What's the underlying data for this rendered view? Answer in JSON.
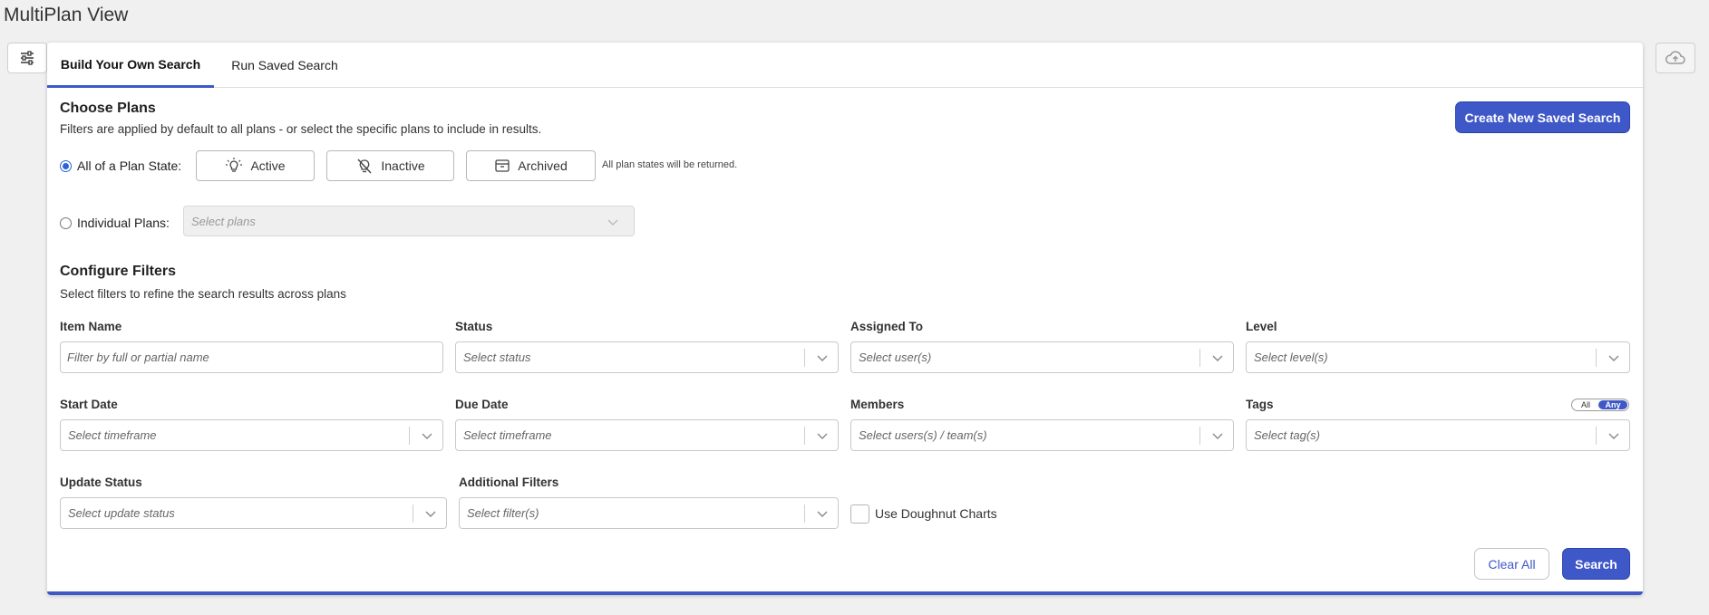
{
  "page": {
    "title": "MultiPlan View"
  },
  "toolbar": {
    "filter_icon": "sliders-icon",
    "cloud_icon": "cloud-upload-icon"
  },
  "tabs": [
    {
      "label": "Build Your Own Search",
      "active": true
    },
    {
      "label": "Run Saved Search",
      "active": false
    }
  ],
  "choose_plans": {
    "title": "Choose Plans",
    "description": "Filters are applied by default to all plans - or select the specific plans to include in results.",
    "create_button": "Create New Saved Search",
    "plan_state_label": "All of a Plan State:",
    "states": [
      {
        "label": "Active",
        "icon": "lightbulb-icon"
      },
      {
        "label": "Inactive",
        "icon": "lightbulb-off-icon"
      },
      {
        "label": "Archived",
        "icon": "archive-box-icon"
      }
    ],
    "state_note": "All plan states will be returned.",
    "individual_label": "Individual Plans:",
    "individual_placeholder": "Select plans"
  },
  "configure_filters": {
    "title": "Configure Filters",
    "description": "Select filters to refine the search results across plans",
    "fields": {
      "item_name": {
        "label": "Item Name",
        "placeholder": "Filter by full or partial name"
      },
      "status": {
        "label": "Status",
        "placeholder": "Select status"
      },
      "assigned_to": {
        "label": "Assigned To",
        "placeholder": "Select user(s)"
      },
      "level": {
        "label": "Level",
        "placeholder": "Select level(s)"
      },
      "start_date": {
        "label": "Start Date",
        "placeholder": "Select timeframe"
      },
      "due_date": {
        "label": "Due Date",
        "placeholder": "Select timeframe"
      },
      "members": {
        "label": "Members",
        "placeholder": "Select users(s) / team(s)"
      },
      "tags": {
        "label": "Tags",
        "placeholder": "Select tag(s)",
        "toggle_all": "All",
        "toggle_any": "Any"
      },
      "update_status": {
        "label": "Update Status",
        "placeholder": "Select update status"
      },
      "additional_filters": {
        "label": "Additional Filters",
        "placeholder": "Select filter(s)"
      }
    },
    "doughnut_label": "Use Doughnut Charts"
  },
  "actions": {
    "clear_all": "Clear All",
    "search": "Search"
  },
  "colors": {
    "accent": "#3f58c8",
    "radio": "#2a62d8"
  }
}
